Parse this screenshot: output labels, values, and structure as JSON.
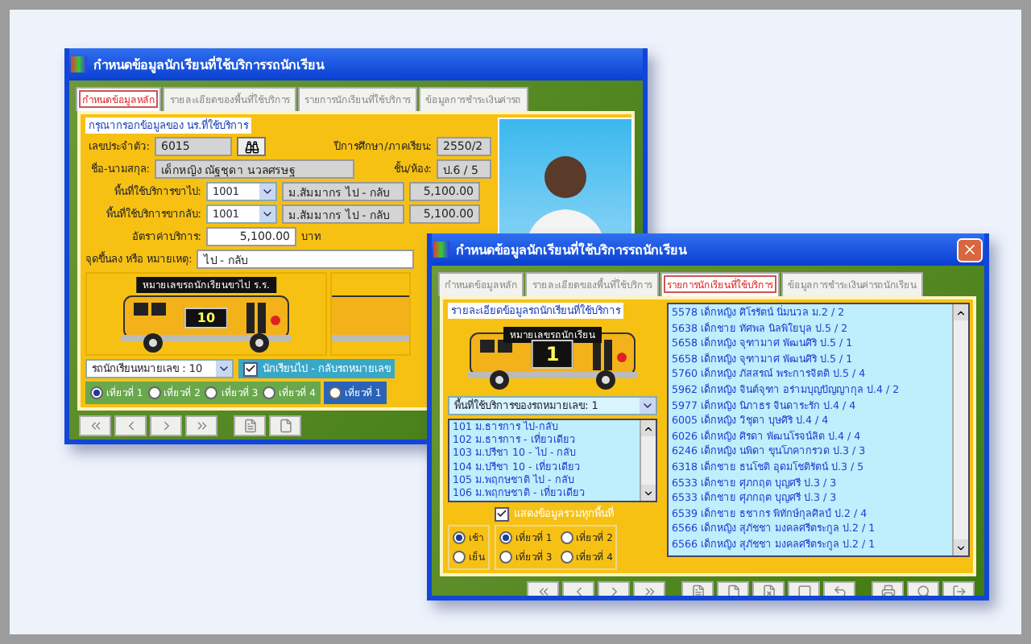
{
  "back_window": {
    "title": "กำหนดข้อมูลนักเรียนที่ใช้บริการรถนักเรียน",
    "tabs": [
      {
        "label": "กำหนดข้อมูลหลัก",
        "selected": true
      },
      {
        "label": "รายละเอียดของพื้นที่ใช้บริการ",
        "selected": false
      },
      {
        "label": "รายการนักเรียนที่ใช้บริการ",
        "selected": false
      },
      {
        "label": "ข้อมูลการชำระเงินค่ารถ",
        "selected": false
      }
    ],
    "group_title": "กรุณากรอกข้อมูลของ นร.ที่ใช้บริการ",
    "student_id": {
      "label": "เลขประจำตัว:",
      "value": "6015"
    },
    "term": {
      "label": "ปีการศึกษา/ภาคเรียน:",
      "value": "2550/2"
    },
    "name": {
      "label": "ชื่อ-นามสกุล:",
      "value": "เด็กหญิง ณัฐชุดา   นวลศรษฐ"
    },
    "class": {
      "label": "ชั้น/ห้อง:",
      "value": "ป.6 / 5"
    },
    "areas": [
      {
        "label": "พื้นที่ใช้บริการขาไป:",
        "code": "1001",
        "area": "ม.สัมมากร ไป - กลับ",
        "amount": "5,100.00"
      },
      {
        "label": "พื้นที่ใช้บริการขากลับ:",
        "code": "1001",
        "area": "ม.สัมมากร ไป - กลับ",
        "amount": "5,100.00"
      }
    ],
    "rate": {
      "label": "อัตราค่าบริการ:",
      "value": "5,100.00",
      "unit": "บาท"
    },
    "note": {
      "label": "จุดขึ้นลง หรือ หมายเหตุ:",
      "value": "ไป - กลับ"
    },
    "bus": {
      "label": "หมายเลขรถนักเรียนขาไป ร.ร.",
      "number": "10"
    },
    "bus_select": "รถนักเรียนหมายเลข : 10",
    "same_bus": {
      "label": "นักเรียนไป - กลับรถหมายเลข",
      "checked": true
    },
    "trips": [
      {
        "label": "เที่ยวที่ 1",
        "selected": true
      },
      {
        "label": "เที่ยวที่ 2",
        "selected": false
      },
      {
        "label": "เที่ยวที่ 3",
        "selected": false
      },
      {
        "label": "เที่ยวที่ 4",
        "selected": false
      }
    ],
    "trips_2": [
      {
        "label": "เที่ยวที่ 1",
        "selected": false
      }
    ]
  },
  "front_window": {
    "title": "กำหนดข้อมูลนักเรียนที่ใช้บริการรถนักเรียน",
    "tabs": [
      {
        "label": "กำหนดข้อมูลหลัก",
        "selected": false
      },
      {
        "label": "รายละเอียดของพื้นที่ใช้บริการ",
        "selected": false
      },
      {
        "label": "รายการนักเรียนที่ใช้บริการ",
        "selected": true
      },
      {
        "label": "ข้อมูลการชำระเงินค่ารถนักเรียน",
        "selected": false
      }
    ],
    "group_title": "รายละเอียดข้อมูลรถนักเรียนที่ใช้บริการ",
    "bus": {
      "label": "หมายเลขรถนักเรียน",
      "number": "1"
    },
    "area_select": "พื้นที่ใช้บริการของรถหมายเลข:   1",
    "areas": [
      "101 ม.ธารการ ไป-กลับ",
      "102 ม.ธารการ - เที่ยวเดียว",
      "103 ม.ปรีชา 10 - ไป - กลับ",
      "104 ม.ปรีชา 10 - เที่ยวเดียว",
      "105 ม.พฤกษชาติ ไป - กลับ",
      "106 ม.พฤกษชาติ - เที่ยวเดียว"
    ],
    "show_all": {
      "label": "แสดงข้อมูลรวมทุกพื้นที่",
      "checked": true
    },
    "periods": [
      {
        "label": "เช้า",
        "selected": true
      },
      {
        "label": "เย็น",
        "selected": false
      }
    ],
    "trips": [
      {
        "label": "เที่ยวที่ 1",
        "selected": true
      },
      {
        "label": "เที่ยวที่ 2",
        "selected": false
      },
      {
        "label": "เที่ยวที่ 3",
        "selected": false
      },
      {
        "label": "เที่ยวที่ 4",
        "selected": false
      }
    ],
    "students": [
      "5578 เด็กหญิง ศิโรรัตน์   นิ่มนวล ม.2 / 2",
      "5638 เด็กชาย ทัศพล   นิลพิใยบุล ป.5 / 2",
      "5658 เด็กหญิง จุฑามาศ   พัฒนศิริ ป.5 / 1",
      "5658 เด็กหญิง จุฑามาศ   พัฒนศิริ ป.5 / 1",
      "5760 เด็กหญิง ภัสสรณ์   พระการจิตติ ป.5 / 4",
      "5962 เด็กหญิง จินต์จุฑา   อร่ามบุญปัญญากุล ป.4 / 2",
      "5977 เด็กหญิง นิภาธร   จินดาระรัก ป.4 / 4",
      "6005 เด็กหญิง วิชุดา   บุษศิริ ป.4 / 4",
      "6026 เด็กหญิง ศิรดา   พัฒนโรจน์ลิต ป.4 / 4",
      "6246 เด็กหญิง นพิดา   ขุนโภคากรวด ป.3 / 3",
      "6318 เด็กชาย ธนโชติ   อุดมโชติรัตน์ ป.3 / 5",
      "6533 เด็กชาย ศุภกฤต   บุญศรี ป.3 / 3",
      "6533 เด็กชาย ศุภกฤต   บุญศรี ป.3 / 3",
      "6539 เด็กชาย ธชากร   พิทักษ์กุลศิลป์ ป.2 / 4",
      "6566 เด็กหญิง สุภัชชา   มงคลศรีตระกูล ป.2 / 1",
      "6566 เด็กหญิง สุภัชชา   มงคลศรีตระกูล ป.2 / 1"
    ]
  }
}
